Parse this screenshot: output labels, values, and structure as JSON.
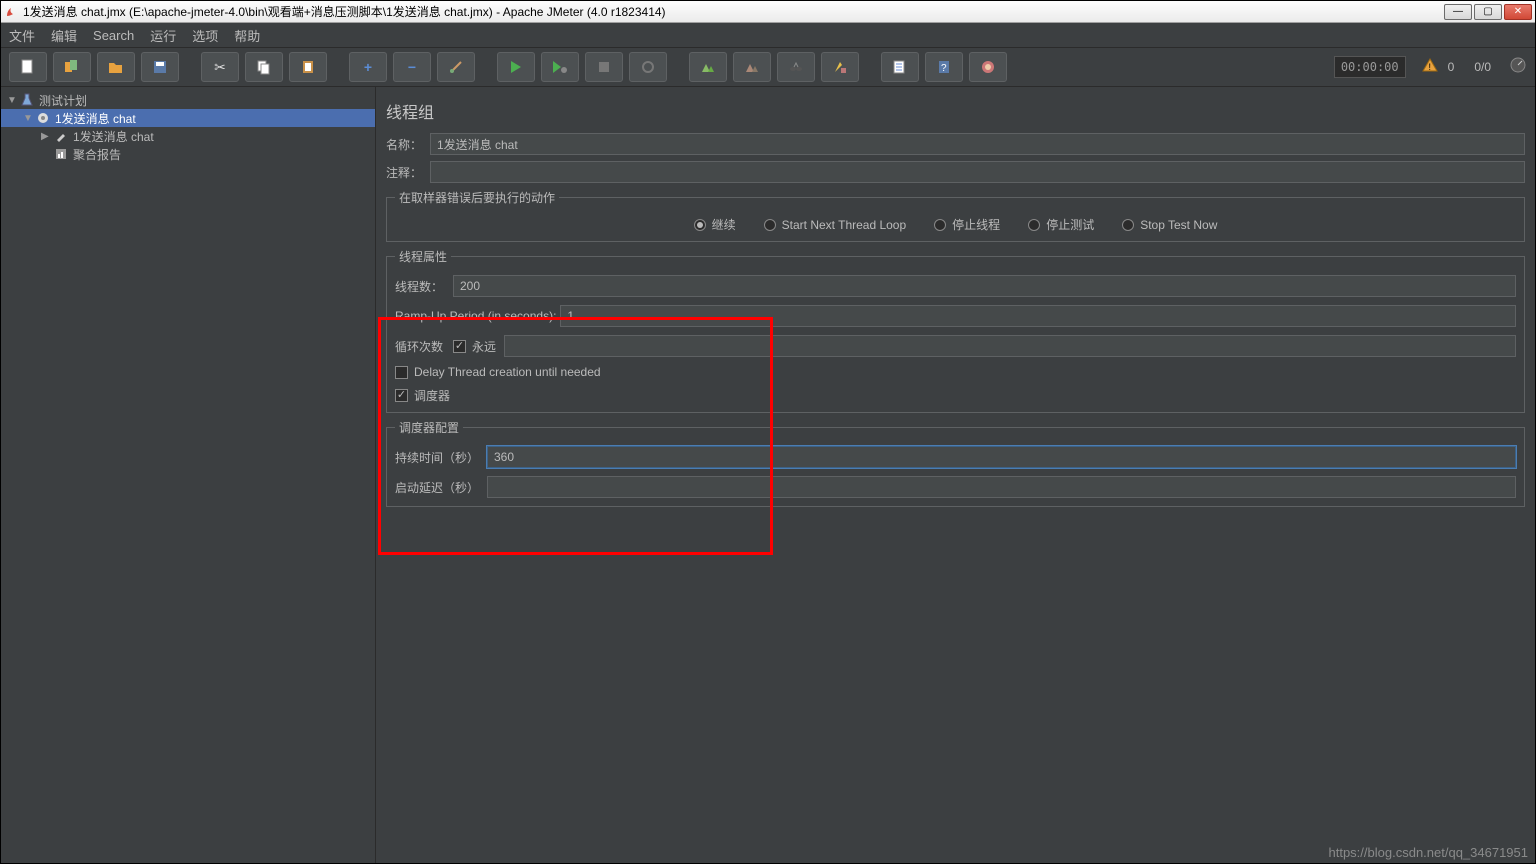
{
  "titlebar": {
    "text": "1发送消息 chat.jmx (E:\\apache-jmeter-4.0\\bin\\观看端+消息压测脚本\\1发送消息 chat.jmx) - Apache JMeter (4.0 r1823414)"
  },
  "menu": {
    "file": "文件",
    "edit": "编辑",
    "search": "Search",
    "run": "运行",
    "options": "选项",
    "help": "帮助"
  },
  "status": {
    "timer": "00:00:00",
    "warn_count": "0",
    "thread_count": "0/0"
  },
  "tree": {
    "root": "测试计划",
    "group": "1发送消息 chat",
    "sampler": "1发送消息 chat",
    "report": "聚合报告"
  },
  "panel": {
    "title": "线程组",
    "name_label": "名称：",
    "name_value": "1发送消息 chat",
    "comment_label": "注释：",
    "comment_value": "",
    "error_legend": "在取样器错误后要执行的动作",
    "radios": {
      "continue": "继续",
      "next_loop": "Start Next Thread Loop",
      "stop_thread": "停止线程",
      "stop_test": "停止测试",
      "stop_now": "Stop Test Now"
    },
    "thread_props_legend": "线程属性",
    "threads_label": "线程数：",
    "threads_value": "200",
    "rampup_label": "Ramp-Up Period (in seconds):",
    "rampup_value": "1",
    "loop_label": "循环次数",
    "forever": "永远",
    "loop_value": "",
    "delay_thread": "Delay Thread creation until needed",
    "scheduler": "调度器",
    "sched_legend": "调度器配置",
    "duration_label": "持续时间（秒）",
    "duration_value": "360",
    "delay_label": "启动延迟（秒）",
    "delay_value": ""
  },
  "watermark": "https://blog.csdn.net/qq_34671951"
}
